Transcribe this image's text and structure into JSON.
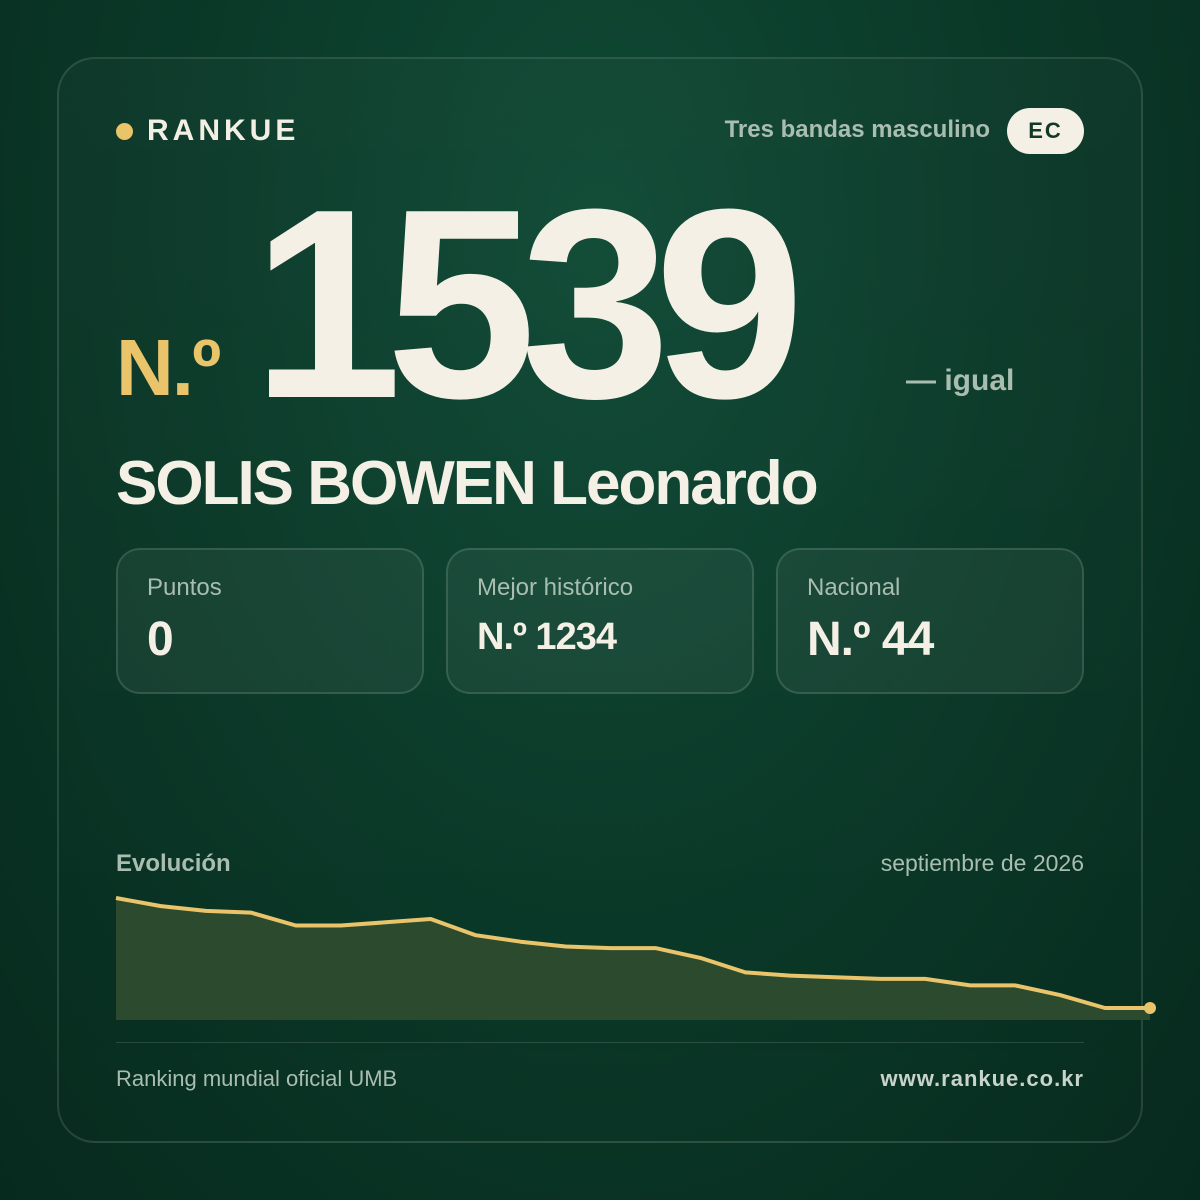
{
  "brand": {
    "name": "RANKUE",
    "dot_color": "#e9c46a"
  },
  "header": {
    "category": "Tres bandas masculino",
    "country_code": "EC"
  },
  "rank": {
    "prefix": "N.º",
    "number": "1539",
    "change": "— igual"
  },
  "player": {
    "name": "SOLIS BOWEN Leonardo"
  },
  "stats": [
    {
      "label": "Puntos",
      "value": "0"
    },
    {
      "label": "Mejor histórico",
      "value": "N.º 1234"
    },
    {
      "label": "Nacional",
      "value": "N.º 44"
    }
  ],
  "chart": {
    "title": "Evolución",
    "date": "septiembre de 2026"
  },
  "chart_data": {
    "type": "area",
    "title": "Evolución",
    "xlabel": "",
    "ylabel": "",
    "grid": false,
    "line_color": "#e9c46a",
    "fill_color": "#2c4a2e",
    "values": [
      0.0,
      0.05,
      0.08,
      0.09,
      0.17,
      0.17,
      0.15,
      0.13,
      0.23,
      0.27,
      0.3,
      0.31,
      0.31,
      0.37,
      0.46,
      0.48,
      0.49,
      0.5,
      0.5,
      0.54,
      0.54,
      0.6,
      0.68,
      0.68
    ]
  },
  "footer": {
    "left": "Ranking mundial oficial UMB",
    "right": "www.rankue.co.kr"
  }
}
